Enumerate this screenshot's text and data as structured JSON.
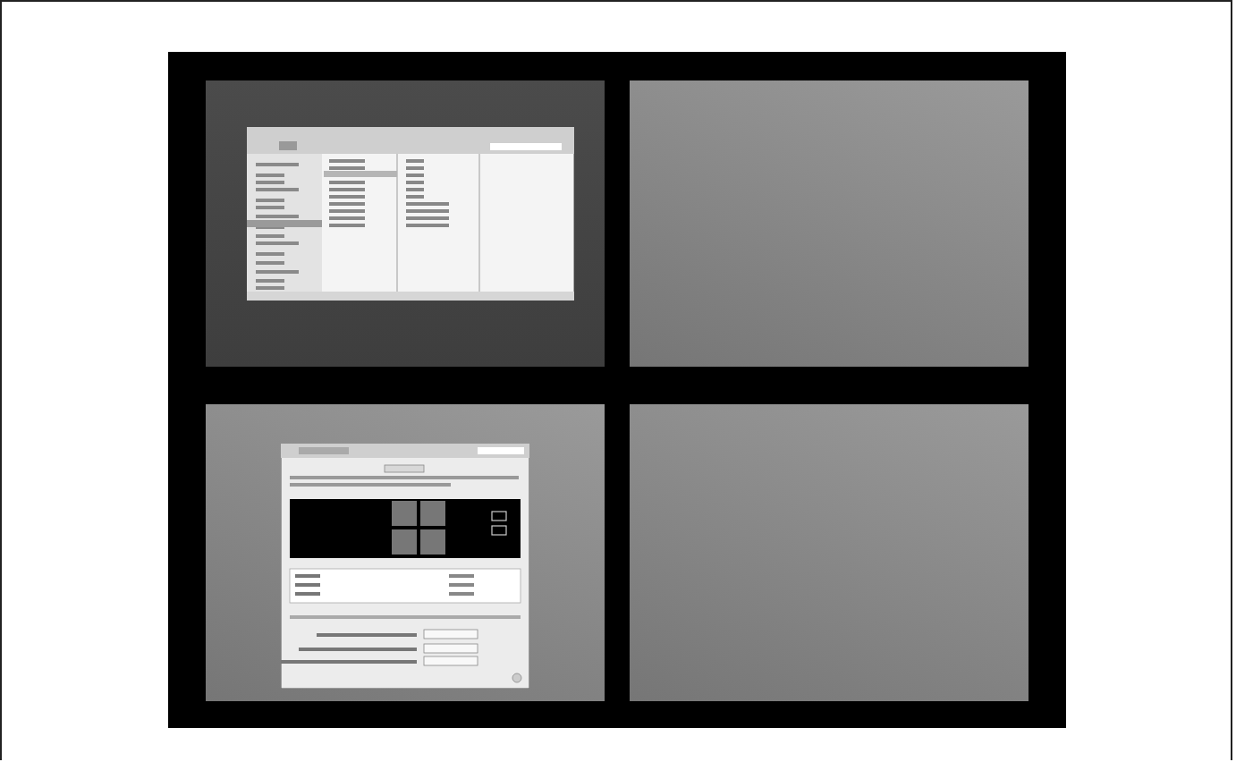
{
  "spaces": [
    {
      "kind": "finder",
      "dimmed": true
    },
    {
      "kind": "empty",
      "dimmed": false
    },
    {
      "kind": "preferences",
      "dimmed": false
    },
    {
      "kind": "empty",
      "dimmed": false
    }
  ]
}
